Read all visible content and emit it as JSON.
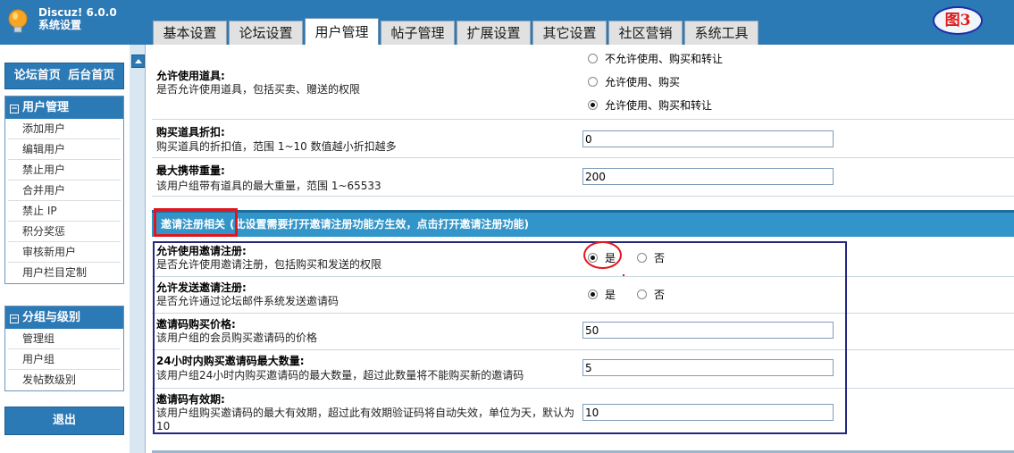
{
  "header": {
    "app_name": "Discuz! 6.0.0",
    "app_sub": "系统设置",
    "figure_label": "图3",
    "tabs": [
      "基本设置",
      "论坛设置",
      "用户管理",
      "帖子管理",
      "扩展设置",
      "其它设置",
      "社区营销",
      "系统工具"
    ],
    "active_tab": "用户管理"
  },
  "sidebar": {
    "forum_home": "论坛首页",
    "admin_home": "后台首页",
    "group_user": {
      "title": "用户管理",
      "items": [
        "添加用户",
        "编辑用户",
        "禁止用户",
        "合并用户",
        "禁止 IP",
        "积分奖惩",
        "审核新用户",
        "用户栏目定制"
      ]
    },
    "group_level": {
      "title": "分组与级别",
      "items": [
        "管理组",
        "用户组",
        "发帖数级别"
      ]
    },
    "logout": "退出"
  },
  "settings": {
    "allow_items": {
      "title": "允许使用道具:",
      "desc": "是否允许使用道具，包括买卖、赠送的权限",
      "options": [
        "不允许使用、购买和转让",
        "允许使用、购买",
        "允许使用、购买和转让"
      ],
      "selected": 2
    },
    "item_discount": {
      "title": "购买道具折扣:",
      "desc": "购买道具的折扣值，范围 1~10 数值越小折扣越多",
      "value": "0"
    },
    "max_weight": {
      "title": "最大携带重量:",
      "desc": "该用户组带有道具的最大重量，范围 1~65533",
      "value": "200"
    }
  },
  "invite": {
    "section_title": "邀请注册相关",
    "section_note": "(此设置需要打开邀请注册功能方生效，点击打开邀请注册功能)",
    "allow_invite": {
      "title": "允许使用邀请注册:",
      "desc": "是否允许使用邀请注册，包括购买和发送的权限",
      "yes": "是",
      "no": "否",
      "selected": "yes"
    },
    "allow_send": {
      "title": "允许发送邀请注册:",
      "desc": "是否允许通过论坛邮件系统发送邀请码",
      "yes": "是",
      "no": "否",
      "selected": "yes"
    },
    "price": {
      "title": "邀请码购买价格:",
      "desc": "该用户组的会员购买邀请码的价格",
      "value": "50"
    },
    "max_24h": {
      "title": "24小时内购买邀请码最大数量:",
      "desc": "该用户组24小时内购买邀请码的最大数量，超过此数量将不能购买新的邀请码",
      "value": "5"
    },
    "validity": {
      "title": "邀请码有效期:",
      "desc_line1": "该用户组购买邀请码的最大有效期，超过此有效期验证码将自动失效，单位为天，默认为",
      "desc_line2": "10",
      "value": "10"
    }
  },
  "colors": {
    "header_bg": "#2b79b5",
    "section_bar": "#3195c9",
    "annotation_red": "#e0161f",
    "annotation_blue": "#23287f"
  }
}
